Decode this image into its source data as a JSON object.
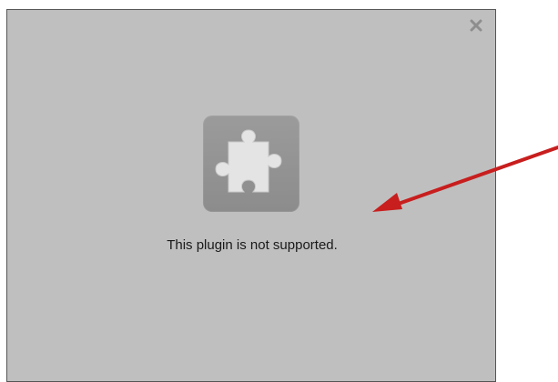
{
  "plugin_placeholder": {
    "message": "This plugin is not supported.",
    "icon": "puzzle-piece-icon",
    "close_icon": "close-icon",
    "colors": {
      "background": "#bfbfbf",
      "border": "#555555",
      "tile": "#929292",
      "piece": "#e2e2e2",
      "close": "#8e8e8e",
      "text": "#1a1a1a"
    }
  },
  "annotation": {
    "icon": "red-arrow-icon",
    "color": "#c81e1e"
  }
}
